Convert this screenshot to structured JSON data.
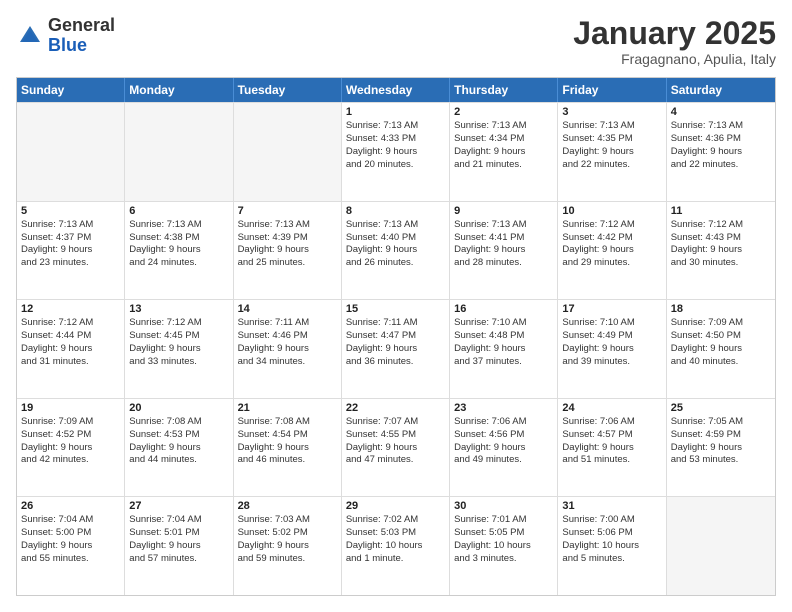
{
  "header": {
    "logo_general": "General",
    "logo_blue": "Blue",
    "month_title": "January 2025",
    "location": "Fragagnano, Apulia, Italy"
  },
  "weekdays": [
    "Sunday",
    "Monday",
    "Tuesday",
    "Wednesday",
    "Thursday",
    "Friday",
    "Saturday"
  ],
  "rows": [
    [
      {
        "day": "",
        "info": "",
        "empty": true
      },
      {
        "day": "",
        "info": "",
        "empty": true
      },
      {
        "day": "",
        "info": "",
        "empty": true
      },
      {
        "day": "1",
        "info": "Sunrise: 7:13 AM\nSunset: 4:33 PM\nDaylight: 9 hours\nand 20 minutes.",
        "empty": false
      },
      {
        "day": "2",
        "info": "Sunrise: 7:13 AM\nSunset: 4:34 PM\nDaylight: 9 hours\nand 21 minutes.",
        "empty": false
      },
      {
        "day": "3",
        "info": "Sunrise: 7:13 AM\nSunset: 4:35 PM\nDaylight: 9 hours\nand 22 minutes.",
        "empty": false
      },
      {
        "day": "4",
        "info": "Sunrise: 7:13 AM\nSunset: 4:36 PM\nDaylight: 9 hours\nand 22 minutes.",
        "empty": false
      }
    ],
    [
      {
        "day": "5",
        "info": "Sunrise: 7:13 AM\nSunset: 4:37 PM\nDaylight: 9 hours\nand 23 minutes.",
        "empty": false
      },
      {
        "day": "6",
        "info": "Sunrise: 7:13 AM\nSunset: 4:38 PM\nDaylight: 9 hours\nand 24 minutes.",
        "empty": false
      },
      {
        "day": "7",
        "info": "Sunrise: 7:13 AM\nSunset: 4:39 PM\nDaylight: 9 hours\nand 25 minutes.",
        "empty": false
      },
      {
        "day": "8",
        "info": "Sunrise: 7:13 AM\nSunset: 4:40 PM\nDaylight: 9 hours\nand 26 minutes.",
        "empty": false
      },
      {
        "day": "9",
        "info": "Sunrise: 7:13 AM\nSunset: 4:41 PM\nDaylight: 9 hours\nand 28 minutes.",
        "empty": false
      },
      {
        "day": "10",
        "info": "Sunrise: 7:12 AM\nSunset: 4:42 PM\nDaylight: 9 hours\nand 29 minutes.",
        "empty": false
      },
      {
        "day": "11",
        "info": "Sunrise: 7:12 AM\nSunset: 4:43 PM\nDaylight: 9 hours\nand 30 minutes.",
        "empty": false
      }
    ],
    [
      {
        "day": "12",
        "info": "Sunrise: 7:12 AM\nSunset: 4:44 PM\nDaylight: 9 hours\nand 31 minutes.",
        "empty": false
      },
      {
        "day": "13",
        "info": "Sunrise: 7:12 AM\nSunset: 4:45 PM\nDaylight: 9 hours\nand 33 minutes.",
        "empty": false
      },
      {
        "day": "14",
        "info": "Sunrise: 7:11 AM\nSunset: 4:46 PM\nDaylight: 9 hours\nand 34 minutes.",
        "empty": false
      },
      {
        "day": "15",
        "info": "Sunrise: 7:11 AM\nSunset: 4:47 PM\nDaylight: 9 hours\nand 36 minutes.",
        "empty": false
      },
      {
        "day": "16",
        "info": "Sunrise: 7:10 AM\nSunset: 4:48 PM\nDaylight: 9 hours\nand 37 minutes.",
        "empty": false
      },
      {
        "day": "17",
        "info": "Sunrise: 7:10 AM\nSunset: 4:49 PM\nDaylight: 9 hours\nand 39 minutes.",
        "empty": false
      },
      {
        "day": "18",
        "info": "Sunrise: 7:09 AM\nSunset: 4:50 PM\nDaylight: 9 hours\nand 40 minutes.",
        "empty": false
      }
    ],
    [
      {
        "day": "19",
        "info": "Sunrise: 7:09 AM\nSunset: 4:52 PM\nDaylight: 9 hours\nand 42 minutes.",
        "empty": false
      },
      {
        "day": "20",
        "info": "Sunrise: 7:08 AM\nSunset: 4:53 PM\nDaylight: 9 hours\nand 44 minutes.",
        "empty": false
      },
      {
        "day": "21",
        "info": "Sunrise: 7:08 AM\nSunset: 4:54 PM\nDaylight: 9 hours\nand 46 minutes.",
        "empty": false
      },
      {
        "day": "22",
        "info": "Sunrise: 7:07 AM\nSunset: 4:55 PM\nDaylight: 9 hours\nand 47 minutes.",
        "empty": false
      },
      {
        "day": "23",
        "info": "Sunrise: 7:06 AM\nSunset: 4:56 PM\nDaylight: 9 hours\nand 49 minutes.",
        "empty": false
      },
      {
        "day": "24",
        "info": "Sunrise: 7:06 AM\nSunset: 4:57 PM\nDaylight: 9 hours\nand 51 minutes.",
        "empty": false
      },
      {
        "day": "25",
        "info": "Sunrise: 7:05 AM\nSunset: 4:59 PM\nDaylight: 9 hours\nand 53 minutes.",
        "empty": false
      }
    ],
    [
      {
        "day": "26",
        "info": "Sunrise: 7:04 AM\nSunset: 5:00 PM\nDaylight: 9 hours\nand 55 minutes.",
        "empty": false
      },
      {
        "day": "27",
        "info": "Sunrise: 7:04 AM\nSunset: 5:01 PM\nDaylight: 9 hours\nand 57 minutes.",
        "empty": false
      },
      {
        "day": "28",
        "info": "Sunrise: 7:03 AM\nSunset: 5:02 PM\nDaylight: 9 hours\nand 59 minutes.",
        "empty": false
      },
      {
        "day": "29",
        "info": "Sunrise: 7:02 AM\nSunset: 5:03 PM\nDaylight: 10 hours\nand 1 minute.",
        "empty": false
      },
      {
        "day": "30",
        "info": "Sunrise: 7:01 AM\nSunset: 5:05 PM\nDaylight: 10 hours\nand 3 minutes.",
        "empty": false
      },
      {
        "day": "31",
        "info": "Sunrise: 7:00 AM\nSunset: 5:06 PM\nDaylight: 10 hours\nand 5 minutes.",
        "empty": false
      },
      {
        "day": "",
        "info": "",
        "empty": true
      }
    ]
  ]
}
